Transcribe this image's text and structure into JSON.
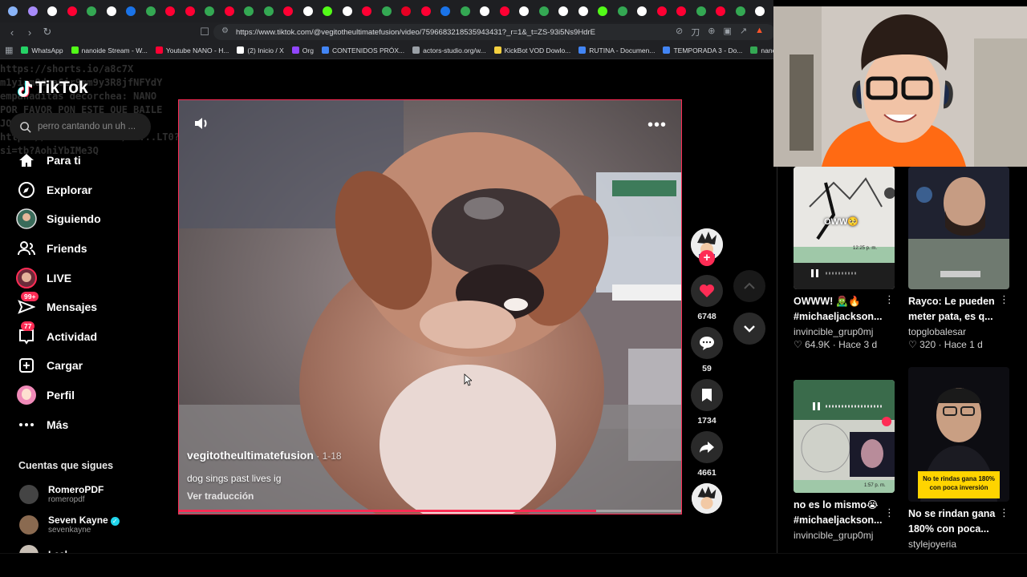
{
  "browser": {
    "url": "https://www.tiktok.com/@vegitotheultimatefusion/video/7596683218535943431?_r=1&_t=ZS-93i5Ns9HdrE",
    "tab_colors": [
      "#8ab4f8",
      "#a78bfa",
      "#ffffff",
      "#ff0033",
      "#34a853",
      "#ffffff",
      "#1a73e8",
      "#34a853",
      "#ff0033",
      "#ff0033",
      "#34a853",
      "#ff0033",
      "#34a853",
      "#34a853",
      "#ff0033",
      "#ffffff",
      "#53fc18",
      "#ffffff",
      "#ff0033",
      "#34a853",
      "#e60023",
      "#ff0033",
      "#1a73e8",
      "#34a853",
      "#ffffff",
      "#ff0033",
      "#ffffff",
      "#34a853",
      "#ffffff",
      "#ffffff",
      "#53fc18",
      "#34a853",
      "#ffffff",
      "#ff0033",
      "#ff0033",
      "#34a853",
      "#ff0033",
      "#34a853",
      "#ffffff"
    ],
    "bookmarks": [
      {
        "label": "WhatsApp",
        "color": "#25d366"
      },
      {
        "label": "nanoide Stream - W...",
        "color": "#53fc18"
      },
      {
        "label": "Youtube NANO - H...",
        "color": "#ff0033"
      },
      {
        "label": "(2) Inicio / X",
        "color": "#ffffff"
      },
      {
        "label": "Org",
        "color": "#9146ff"
      },
      {
        "label": "CONTENIDOS PRÓX...",
        "color": "#4285f4"
      },
      {
        "label": "actors-studio.org/w...",
        "color": "#9aa0a6"
      },
      {
        "label": "KickBot VOD Dowlo...",
        "color": "#f4d03f"
      },
      {
        "label": "RUTINA - Documen...",
        "color": "#4285f4"
      },
      {
        "label": "TEMPORADA 3 - Do...",
        "color": "#4285f4"
      },
      {
        "label": "nano -",
        "color": "#34a853"
      }
    ]
  },
  "overlay_text": "https://shorts.io/a8c7X\nm1yiam8dra6ir9mm9y3R8jfNFYdY\nempanaditas decorchea: NANO\nPOR FAVOR PON ESTE QUE BAILE\nJOACO\nhttps://vm.tiktok.com/ZS...LT0?\nsi=tb?AohiYbIMe3Q",
  "sidebar": {
    "logo": "TikTok",
    "search_placeholder": "perro cantando un uh ...",
    "nav": [
      {
        "label": "Para ti",
        "icon": "home-icon"
      },
      {
        "label": "Explorar",
        "icon": "compass-icon"
      },
      {
        "label": "Siguiendo",
        "icon": "following-avatar-icon"
      },
      {
        "label": "Friends",
        "icon": "friends-icon"
      },
      {
        "label": "LIVE",
        "icon": "live-avatar-icon"
      },
      {
        "label": "Mensajes",
        "icon": "messages-icon",
        "badge": "99+"
      },
      {
        "label": "Actividad",
        "icon": "activity-icon",
        "badge": "77"
      },
      {
        "label": "Cargar",
        "icon": "upload-icon"
      },
      {
        "label": "Perfil",
        "icon": "profile-avatar-icon"
      },
      {
        "label": "Más",
        "icon": "more-icon"
      }
    ],
    "following_title": "Cuentas que sigues",
    "following": [
      {
        "name": "RomeroPDF",
        "handle": "romeropdf",
        "verified": false
      },
      {
        "name": "Seven Kayne",
        "handle": "sevenkayne",
        "verified": true
      },
      {
        "name": "Leal",
        "handle": "",
        "verified": false
      }
    ]
  },
  "video": {
    "username": "vegitotheultimatefusion",
    "date": " · 1-18",
    "description": "dog sings past lives ig",
    "translate": "Ver traducción",
    "progress": 0.83
  },
  "actions": {
    "likes": "6748",
    "comments": "59",
    "saves": "1734",
    "shares": "4661"
  },
  "recommendations": [
    {
      "title": "OWWW! 🧟‍♂️🔥 #michaeljackson...",
      "author": "invincible_grup0mj",
      "likes": "64.9K",
      "age": "Hace 3 d",
      "overlay": "OWW🥺",
      "time": "12:25 p. m."
    },
    {
      "title": "Rayco: Le pueden meter pata, es q...",
      "author": "topglobalesar",
      "likes": "320",
      "age": "Hace 1 d",
      "overlay": "",
      "time": ""
    },
    {
      "title": "no es lo mismo😭 #michaeljackson...",
      "author": "invincible_grup0mj",
      "likes": "",
      "age": "",
      "overlay": "",
      "time": "1:57 p. m."
    },
    {
      "title": "No se rindan gana 180% con poca...",
      "author": "stylejoyeria",
      "likes": "",
      "age": "",
      "overlay": "No te rindas gana 180% con poca inversión",
      "time": ""
    }
  ]
}
